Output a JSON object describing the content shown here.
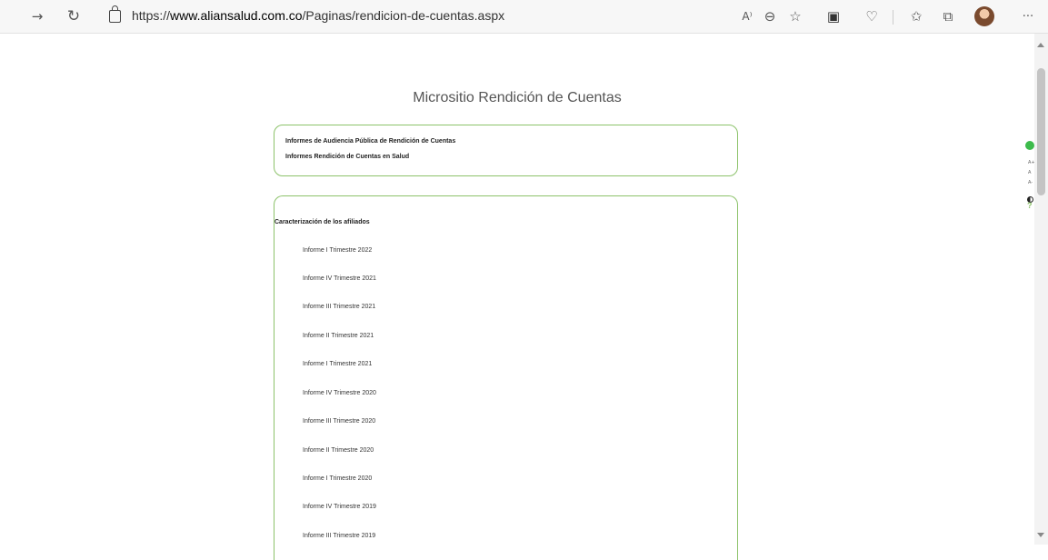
{
  "browser": {
    "url_prefix": "https://",
    "url_host": "www.aliansalud.com.co",
    "url_path": "/Paginas/rendicion-de-cuentas.aspx",
    "read_aloud_label": "A⁾"
  },
  "page": {
    "title": "Micrositio Rendición de Cuentas",
    "box1_links": [
      "Informes de Audiencia Pública de Rendición de Cuentas",
      "Informes Rendición de Cuentas en Salud"
    ],
    "section_heading": "Caracterización de los afiliados",
    "reports": [
      "Informe I Trimestre 2022",
      "Informe IV Trimestre 2021",
      "Informe III Trimestre 2021",
      "Informe II Trimestre 2021",
      "Informe I Trimestre 2021",
      "Informe IV Trimestre 2020",
      "Informe III Trimestre 2020",
      "Informe II Trimestre 2020",
      "Informe I Trimestre 2020",
      "Informe IV Trimestre 2019",
      "Informe III Trimestre 2019"
    ]
  },
  "accessibility_widget": {
    "increase_text": "A+",
    "reset_text": "A",
    "decrease_text": "A-",
    "help": "?"
  }
}
